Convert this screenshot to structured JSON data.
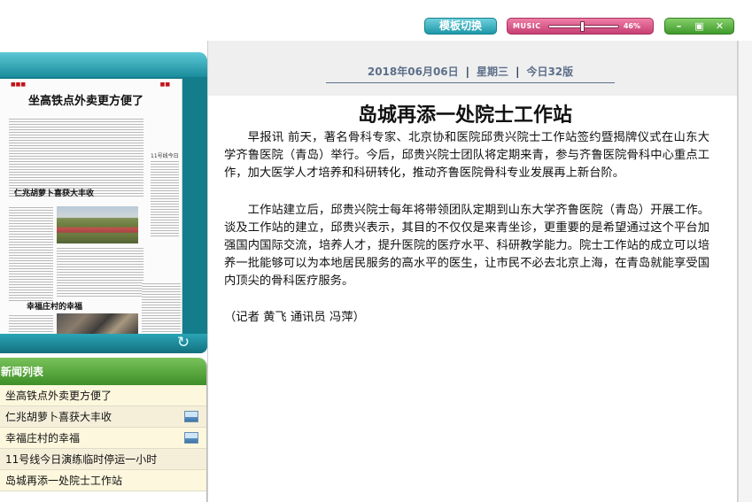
{
  "toolbar": {
    "template_switch_label": "模板切换",
    "music_label": "MUSIC",
    "music_volume_text": "46%",
    "music_volume_fraction": 0.46
  },
  "window_controls": {
    "minimize_icon": "minimize-icon",
    "restore_icon": "restore-icon",
    "close_icon": "close-icon"
  },
  "thumbnail": {
    "headline": "坐高铁点外卖更方便了",
    "headline2": "仁兆胡萝卜喜获大丰收",
    "headline3": "幸福庄村的幸福",
    "side_text": "11号线今日演练",
    "refresh_icon": "refresh-icon"
  },
  "news_list": {
    "title": "新闻列表",
    "items": [
      {
        "label": "坐高铁点外卖更方便了",
        "has_image": false
      },
      {
        "label": "仁兆胡萝卜喜获大丰收",
        "has_image": true
      },
      {
        "label": "幸福庄村的幸福",
        "has_image": true
      },
      {
        "label": "11号线今日演练临时停运一小时",
        "has_image": false
      },
      {
        "label": "岛城再添一处院士工作站",
        "has_image": false
      }
    ]
  },
  "article": {
    "date": "2018年06月06日",
    "weekday": "星期三",
    "edition": "今日32版",
    "title": "岛城再添一处院士工作站",
    "paragraphs": [
      "早报讯 前天，著名骨科专家、北京协和医院邱贵兴院士工作站签约暨揭牌仪式在山东大学齐鲁医院（青岛）举行。今后，邱贵兴院士团队将定期来青，参与齐鲁医院骨科中心重点工作，加大医学人才培养和科研转化，推动齐鲁医院骨科专业发展再上新台阶。",
      "工作站建立后，邱贵兴院士每年将带领团队定期到山东大学齐鲁医院（青岛）开展工作。谈及工作站的建立，邱贵兴表示，其目的不仅仅是来青坐诊，更重要的是希望通过这个平台加强国内国际交流，培养人才，提升医院的医疗水平、科研教学能力。院士工作站的成立可以培养一批能够可以为本地居民服务的高水平的医生，让市民不必去北京上海，在青岛就能享受国内顶尖的骨科医疗服务。"
    ],
    "byline": "（记者 黄飞 通讯员 冯萍）"
  }
}
